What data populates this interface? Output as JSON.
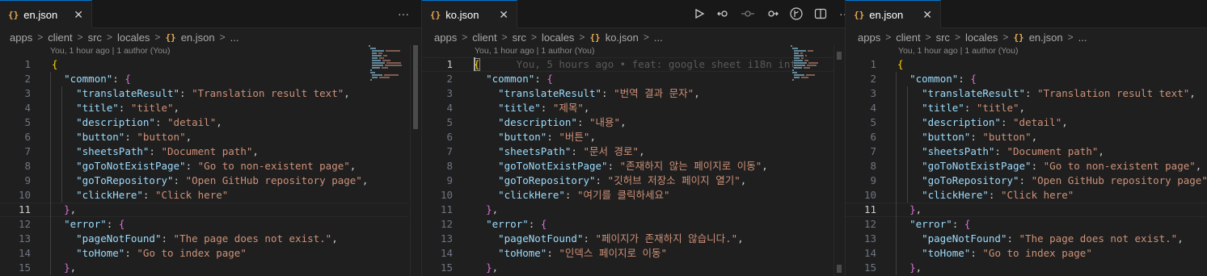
{
  "colors": {
    "background": "#1f1f1f",
    "tabbar": "#181818",
    "key": "#9cdcfe",
    "string": "#ce9178",
    "bracket_level1": "#ffd700",
    "bracket_level2": "#da70d6",
    "json_icon": "#e8ab53"
  },
  "panes": [
    {
      "tab": {
        "icon": "{}",
        "label": "en.json",
        "close": "✕"
      },
      "breadcrumb": [
        "apps",
        "client",
        "src",
        "locales",
        "{}",
        "en.json",
        "..."
      ],
      "blame": "You, 1 hour ago | 1 author (You)",
      "more_actions": "···",
      "lines": [
        {
          "n": "1",
          "key": "",
          "value": "",
          "open": "{",
          "close": ""
        },
        {
          "n": "2",
          "key": "\"common\"",
          "value": "",
          "open": "{",
          "close": ""
        },
        {
          "n": "3",
          "key": "\"translateResult\"",
          "value": "\"Translation result text\"",
          "open": "",
          "close": ","
        },
        {
          "n": "4",
          "key": "\"title\"",
          "value": "\"title\"",
          "open": "",
          "close": ","
        },
        {
          "n": "5",
          "key": "\"description\"",
          "value": "\"detail\"",
          "open": "",
          "close": ","
        },
        {
          "n": "6",
          "key": "\"button\"",
          "value": "\"button\"",
          "open": "",
          "close": ","
        },
        {
          "n": "7",
          "key": "\"sheetsPath\"",
          "value": "\"Document path\"",
          "open": "",
          "close": ","
        },
        {
          "n": "8",
          "key": "\"goToNotExistPage\"",
          "value": "\"Go to non-existent page\"",
          "open": "",
          "close": ","
        },
        {
          "n": "9",
          "key": "\"goToRepository\"",
          "value": "\"Open GitHub repository page\"",
          "open": "",
          "close": ","
        },
        {
          "n": "10",
          "key": "\"clickHere\"",
          "value": "\"Click here\"",
          "open": "",
          "close": ""
        },
        {
          "n": "11",
          "key": "",
          "value": "",
          "open": "}",
          "close": ","
        },
        {
          "n": "12",
          "key": "\"error\"",
          "value": "",
          "open": "{",
          "close": ""
        },
        {
          "n": "13",
          "key": "\"pageNotFound\"",
          "value": "\"The page does not exist.\"",
          "open": "",
          "close": ","
        },
        {
          "n": "14",
          "key": "\"toHome\"",
          "value": "\"Go to index page\"",
          "open": "",
          "close": ""
        },
        {
          "n": "15",
          "key": "",
          "value": "",
          "open": "}",
          "close": ","
        }
      ]
    },
    {
      "tab": {
        "icon": "{}",
        "label": "ko.json",
        "close": "✕"
      },
      "breadcrumb": [
        "apps",
        "client",
        "src",
        "locales",
        "{}",
        "ko.json",
        "..."
      ],
      "blame": "You, 1 hour ago | 1 author (You)",
      "inline_blame": "You, 5 hours ago • feat: google sheet i18n int",
      "actions": [
        "run-icon",
        "compare-changes-icon",
        "git-commit-icon",
        "git-history-icon",
        "git-graph-icon",
        "split-editor-icon"
      ],
      "more_actions": "···",
      "lines": [
        {
          "n": "1",
          "key": "",
          "value": "",
          "open": "{",
          "close": ""
        },
        {
          "n": "2",
          "key": "\"common\"",
          "value": "",
          "open": "{",
          "close": ""
        },
        {
          "n": "3",
          "key": "\"translateResult\"",
          "value": "\"번역 결과 문자\"",
          "open": "",
          "close": ","
        },
        {
          "n": "4",
          "key": "\"title\"",
          "value": "\"제목\"",
          "open": "",
          "close": ","
        },
        {
          "n": "5",
          "key": "\"description\"",
          "value": "\"내용\"",
          "open": "",
          "close": ","
        },
        {
          "n": "6",
          "key": "\"button\"",
          "value": "\"버튼\"",
          "open": "",
          "close": ","
        },
        {
          "n": "7",
          "key": "\"sheetsPath\"",
          "value": "\"문서 경로\"",
          "open": "",
          "close": ","
        },
        {
          "n": "8",
          "key": "\"goToNotExistPage\"",
          "value": "\"존재하지 않는 페이지로 이동\"",
          "open": "",
          "close": ","
        },
        {
          "n": "9",
          "key": "\"goToRepository\"",
          "value": "\"깃허브 저장소 페이지 열기\"",
          "open": "",
          "close": ","
        },
        {
          "n": "10",
          "key": "\"clickHere\"",
          "value": "\"여기를 클릭하세요\"",
          "open": "",
          "close": ""
        },
        {
          "n": "11",
          "key": "",
          "value": "",
          "open": "}",
          "close": ","
        },
        {
          "n": "12",
          "key": "\"error\"",
          "value": "",
          "open": "{",
          "close": ""
        },
        {
          "n": "13",
          "key": "\"pageNotFound\"",
          "value": "\"페이지가 존재하지 않습니다.\"",
          "open": "",
          "close": ","
        },
        {
          "n": "14",
          "key": "\"toHome\"",
          "value": "\"인덱스 페이지로 이동\"",
          "open": "",
          "close": ""
        },
        {
          "n": "15",
          "key": "",
          "value": "",
          "open": "}",
          "close": ","
        }
      ]
    },
    {
      "tab": {
        "icon": "{}",
        "label": "en.json",
        "close": "✕"
      },
      "breadcrumb": [
        "apps",
        "client",
        "src",
        "locales",
        "{}",
        "en.json",
        "..."
      ],
      "blame": "You, 1 hour ago | 1 author (You)",
      "lines": [
        {
          "n": "1",
          "key": "",
          "value": "",
          "open": "{",
          "close": ""
        },
        {
          "n": "2",
          "key": "\"common\"",
          "value": "",
          "open": "{",
          "close": ""
        },
        {
          "n": "3",
          "key": "\"translateResult\"",
          "value": "\"Translation result text\"",
          "open": "",
          "close": ","
        },
        {
          "n": "4",
          "key": "\"title\"",
          "value": "\"title\"",
          "open": "",
          "close": ","
        },
        {
          "n": "5",
          "key": "\"description\"",
          "value": "\"detail\"",
          "open": "",
          "close": ","
        },
        {
          "n": "6",
          "key": "\"button\"",
          "value": "\"button\"",
          "open": "",
          "close": ","
        },
        {
          "n": "7",
          "key": "\"sheetsPath\"",
          "value": "\"Document path\"",
          "open": "",
          "close": ","
        },
        {
          "n": "8",
          "key": "\"goToNotExistPage\"",
          "value": "\"Go to non-existent page\"",
          "open": "",
          "close": ","
        },
        {
          "n": "9",
          "key": "\"goToRepository\"",
          "value": "\"Open GitHub repository page\"",
          "open": "",
          "close": ","
        },
        {
          "n": "10",
          "key": "\"clickHere\"",
          "value": "\"Click here\"",
          "open": "",
          "close": ""
        },
        {
          "n": "11",
          "key": "",
          "value": "",
          "open": "}",
          "close": ","
        },
        {
          "n": "12",
          "key": "\"error\"",
          "value": "",
          "open": "{",
          "close": ""
        },
        {
          "n": "13",
          "key": "\"pageNotFound\"",
          "value": "\"The page does not exist.\"",
          "open": "",
          "close": ","
        },
        {
          "n": "14",
          "key": "\"toHome\"",
          "value": "\"Go to index page\"",
          "open": "",
          "close": ""
        },
        {
          "n": "15",
          "key": "",
          "value": "",
          "open": "}",
          "close": ","
        }
      ]
    }
  ]
}
